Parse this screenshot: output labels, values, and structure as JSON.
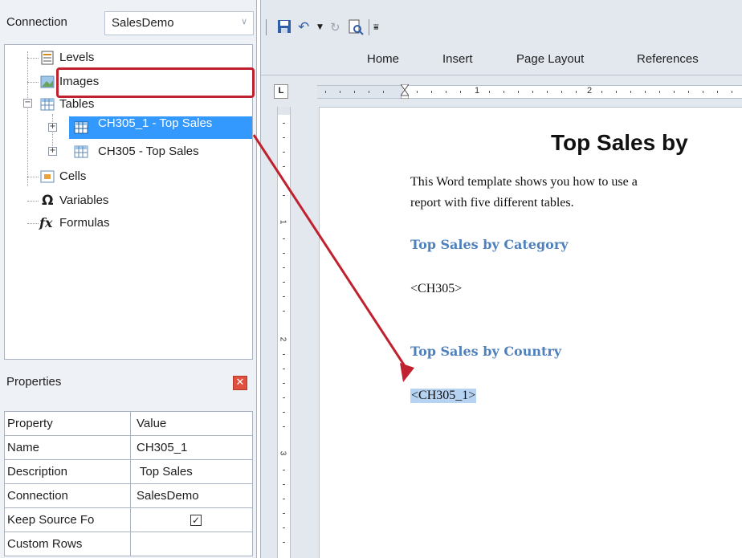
{
  "connection": {
    "label": "Connection",
    "value": "SalesDemo"
  },
  "tree": {
    "items": [
      {
        "label": "Levels",
        "icon": "levels-icon"
      },
      {
        "label": "Images",
        "icon": "images-icon"
      },
      {
        "label": "Tables",
        "icon": "table-icon"
      },
      {
        "label": "CH305_1 -  Top Sales",
        "icon": "table-icon",
        "selected": true
      },
      {
        "label": "CH305 -  Top Sales",
        "icon": "table-icon"
      },
      {
        "label": "Cells",
        "icon": "cells-icon"
      },
      {
        "label": "Variables",
        "icon": "omega-icon",
        "glyph": "Ω"
      },
      {
        "label": "Formulas",
        "icon": "fx-icon",
        "glyph": "fx"
      }
    ]
  },
  "properties": {
    "title": "Properties",
    "close_glyph": "✕",
    "header": {
      "name": "Property",
      "value": "Value"
    },
    "rows": [
      {
        "name": "Name",
        "value": "CH305_1"
      },
      {
        "name": "Description",
        "value": " Top Sales"
      },
      {
        "name": "Connection",
        "value": "SalesDemo"
      },
      {
        "name": "Keep Source Fo",
        "value": "",
        "checked": true,
        "check_glyph": "✓"
      },
      {
        "name": "Custom Rows",
        "value": ""
      }
    ]
  },
  "ribbon": {
    "tabs": [
      "Home",
      "Insert",
      "Page Layout",
      "References"
    ]
  },
  "ruler": {
    "corner": "L",
    "numbers": [
      "1",
      "2"
    ],
    "vnumbers": [
      "1",
      "2",
      "3"
    ]
  },
  "document": {
    "title": "Top Sales by",
    "intro_line1": "This Word template shows you how to use a",
    "intro_line2": "report with five different tables.",
    "heading1": "Top Sales by Category",
    "tag1": "<CH305>",
    "heading2": "Top Sales by Country",
    "tag2": "<CH305_1>"
  },
  "colors": {
    "selection": "#3399ff",
    "highlight_outline": "#c0212e",
    "heading": "#4f81bd"
  }
}
